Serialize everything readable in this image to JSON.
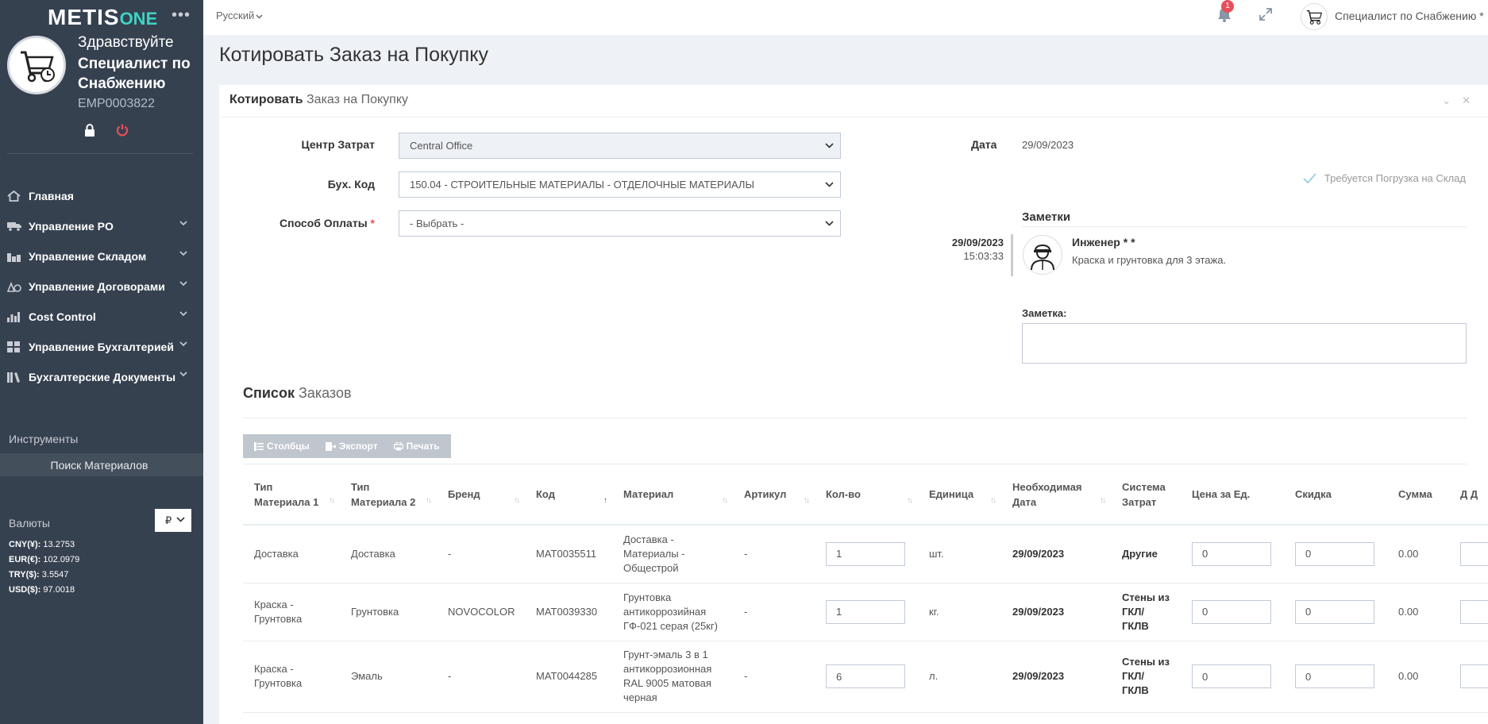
{
  "sidebar": {
    "logo_main": "METIS",
    "logo_sub": "ONE",
    "greeting": "Здравствуйте",
    "user_name": "Специалист по Снабжению",
    "employee_id": "EMP0003822",
    "menu": [
      {
        "label": "Главная",
        "icon": "home-icon"
      },
      {
        "label": "Управление PO",
        "icon": "truck-icon"
      },
      {
        "label": "Управление Складом",
        "icon": "warehouse-icon"
      },
      {
        "label": "Управление Договорами",
        "icon": "contract-icon"
      },
      {
        "label": "Cost Control",
        "icon": "bar-chart-icon"
      },
      {
        "label": "Управление Бухгалтерией",
        "icon": "accounting-icon"
      },
      {
        "label": "Бухгалтерские Документы",
        "icon": "books-icon"
      }
    ],
    "tools_title": "Инструменты",
    "tools_item": "Поиск Материалов",
    "currencies_title": "Валюты",
    "currency_selected": "₽",
    "rates": [
      {
        "code": "CNY(¥):",
        "value": "13.2753"
      },
      {
        "code": "EUR(€):",
        "value": "102.0979"
      },
      {
        "code": "TRY($):",
        "value": "3.5547"
      },
      {
        "code": "USD($):",
        "value": "97.0018"
      }
    ]
  },
  "topbar": {
    "language": "Русский",
    "notifications_count": "1",
    "user_name": "Специалист по Снабжению *"
  },
  "page": {
    "title": "Котировать Заказ на Покупку",
    "portlet_title_bold": "Котировать",
    "portlet_title_rest": " Заказ на Покупку"
  },
  "form": {
    "cost_center_label": "Центр Затрат",
    "cost_center_value": "Central Office",
    "account_label": "Бух. Код",
    "account_value": "150.04 - СТРОИТЕЛЬНЫЕ МАТЕРИАЛЫ - ОТДЕЛОЧНЫЕ МАТЕРИАЛЫ",
    "payment_label": "Способ Оплаты",
    "payment_required": "*",
    "payment_value": "- Выбрать -",
    "date_label": "Дата",
    "date_value": "29/09/2023",
    "warehouse_load_label": "Требуется Погрузка на Склад"
  },
  "notes": {
    "title": "Заметки",
    "entries": [
      {
        "date": "29/09/2023",
        "time": "15:03:33",
        "author": "Инженер * *",
        "text": "Краска и грунтовка для 3 этажа."
      }
    ],
    "input_label": "Заметка:"
  },
  "orders": {
    "title_bold": "Список",
    "title_rest": " Заказов",
    "buttons": {
      "columns": "Столбцы",
      "export": "Экспорт",
      "print": "Печать"
    },
    "columns": [
      "Тип Материала 1",
      "Тип Материала 2",
      "Бренд",
      "Код",
      "Материал",
      "Артикул",
      "Кол-во",
      "Единица",
      "Необходимая Дата",
      "Система Затрат",
      "Цена за Ед.",
      "Скидка",
      "Сумма",
      "Д Д"
    ],
    "rows": [
      {
        "type1": "Доставка",
        "type2": "Доставка",
        "brand": "-",
        "code": "MAT0035511",
        "material": "Доставка - Материалы - Общестрой",
        "article": "-",
        "qty": "1",
        "unit": "шт.",
        "date": "29/09/2023",
        "cost_system": "Другие",
        "price": "0",
        "discount": "0",
        "sum": "0.00"
      },
      {
        "type1": "Краска - Грунтовка",
        "type2": "Грунтовка",
        "brand": "NOVOCOLOR",
        "code": "MAT0039330",
        "material": "Грунтовка антикоррозийная ГФ-021 серая (25кг)",
        "article": "-",
        "qty": "1",
        "unit": "кг.",
        "date": "29/09/2023",
        "cost_system": "Стены из ГКЛ/ ГКЛВ",
        "price": "0",
        "discount": "0",
        "sum": "0.00"
      },
      {
        "type1": "Краска - Грунтовка",
        "type2": "Эмаль",
        "brand": "-",
        "code": "MAT0044285",
        "material": "Грунт-эмаль 3 в 1 антикоррозионная RAL 9005 матовая черная",
        "article": "-",
        "qty": "6",
        "unit": "л.",
        "date": "29/09/2023",
        "cost_system": "Стены из ГКЛ/ ГКЛВ",
        "price": "0",
        "discount": "0",
        "sum": "0.00"
      }
    ]
  }
}
